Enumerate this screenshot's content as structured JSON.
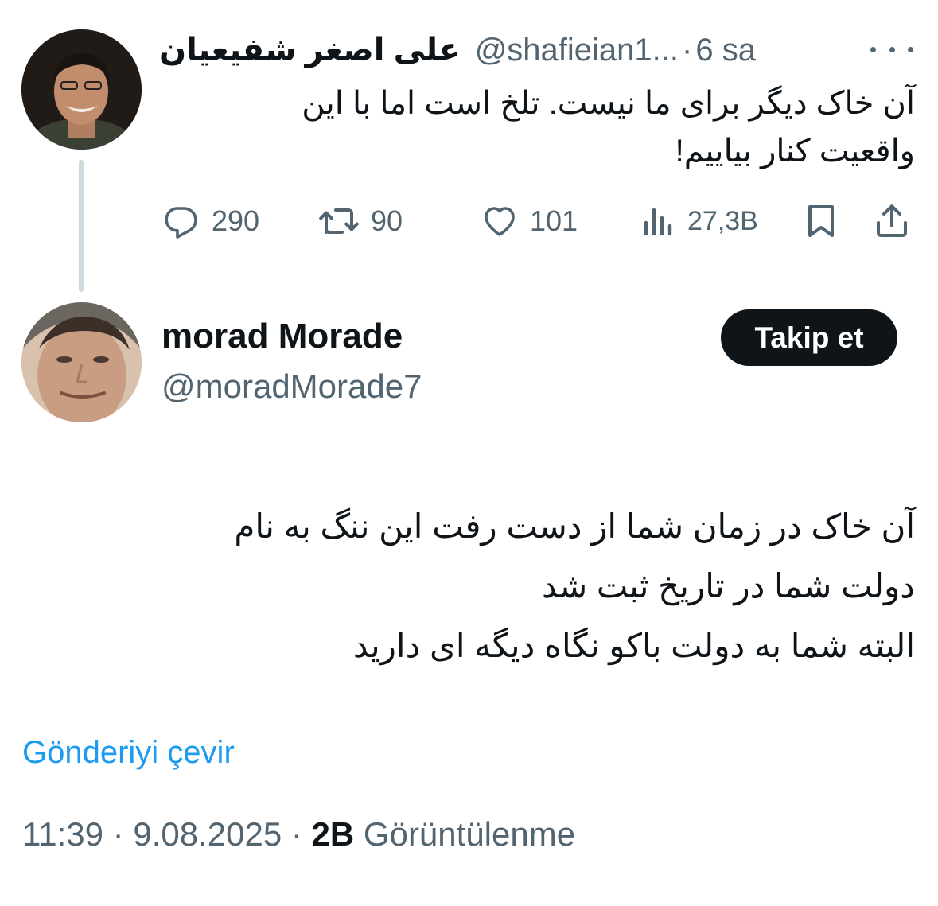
{
  "parent_tweet": {
    "author_name": "علی اصغر شفیعیان",
    "handle": "@shafieian1...",
    "separator": "·",
    "time": "6 sa",
    "text_lines": [
      "آن خاک دیگر برای ما نیست. تلخ است اما با این",
      "واقعیت کنار بیاییم!"
    ],
    "actions": {
      "replies": "290",
      "retweets": "90",
      "likes": "101",
      "views": "27,3B"
    }
  },
  "reply_tweet": {
    "author_name": "morad Morade",
    "handle": "@moradMorade7",
    "follow_label": "Takip et",
    "text_lines": [
      "آن خاک در زمان شما از دست رفت این ننگ به نام",
      "دولت شما در تاریخ ثبت شد",
      "البته شما به دولت باکو نگاه دیگه ای دارید"
    ],
    "translate_label": "Gönderiyi çevir",
    "time": "11:39",
    "date": "9.08.2025",
    "dot": "·",
    "views_count": "2B",
    "views_label": "Görüntülenme"
  },
  "colors": {
    "text_primary": "#0f1419",
    "text_secondary": "#536471",
    "link": "#1d9bf0",
    "thread_line": "#cfd9de",
    "button_bg": "#0f1419"
  },
  "icons": [
    "more-icon",
    "reply-icon",
    "retweet-icon",
    "like-icon",
    "views-icon",
    "bookmark-icon",
    "share-icon"
  ]
}
